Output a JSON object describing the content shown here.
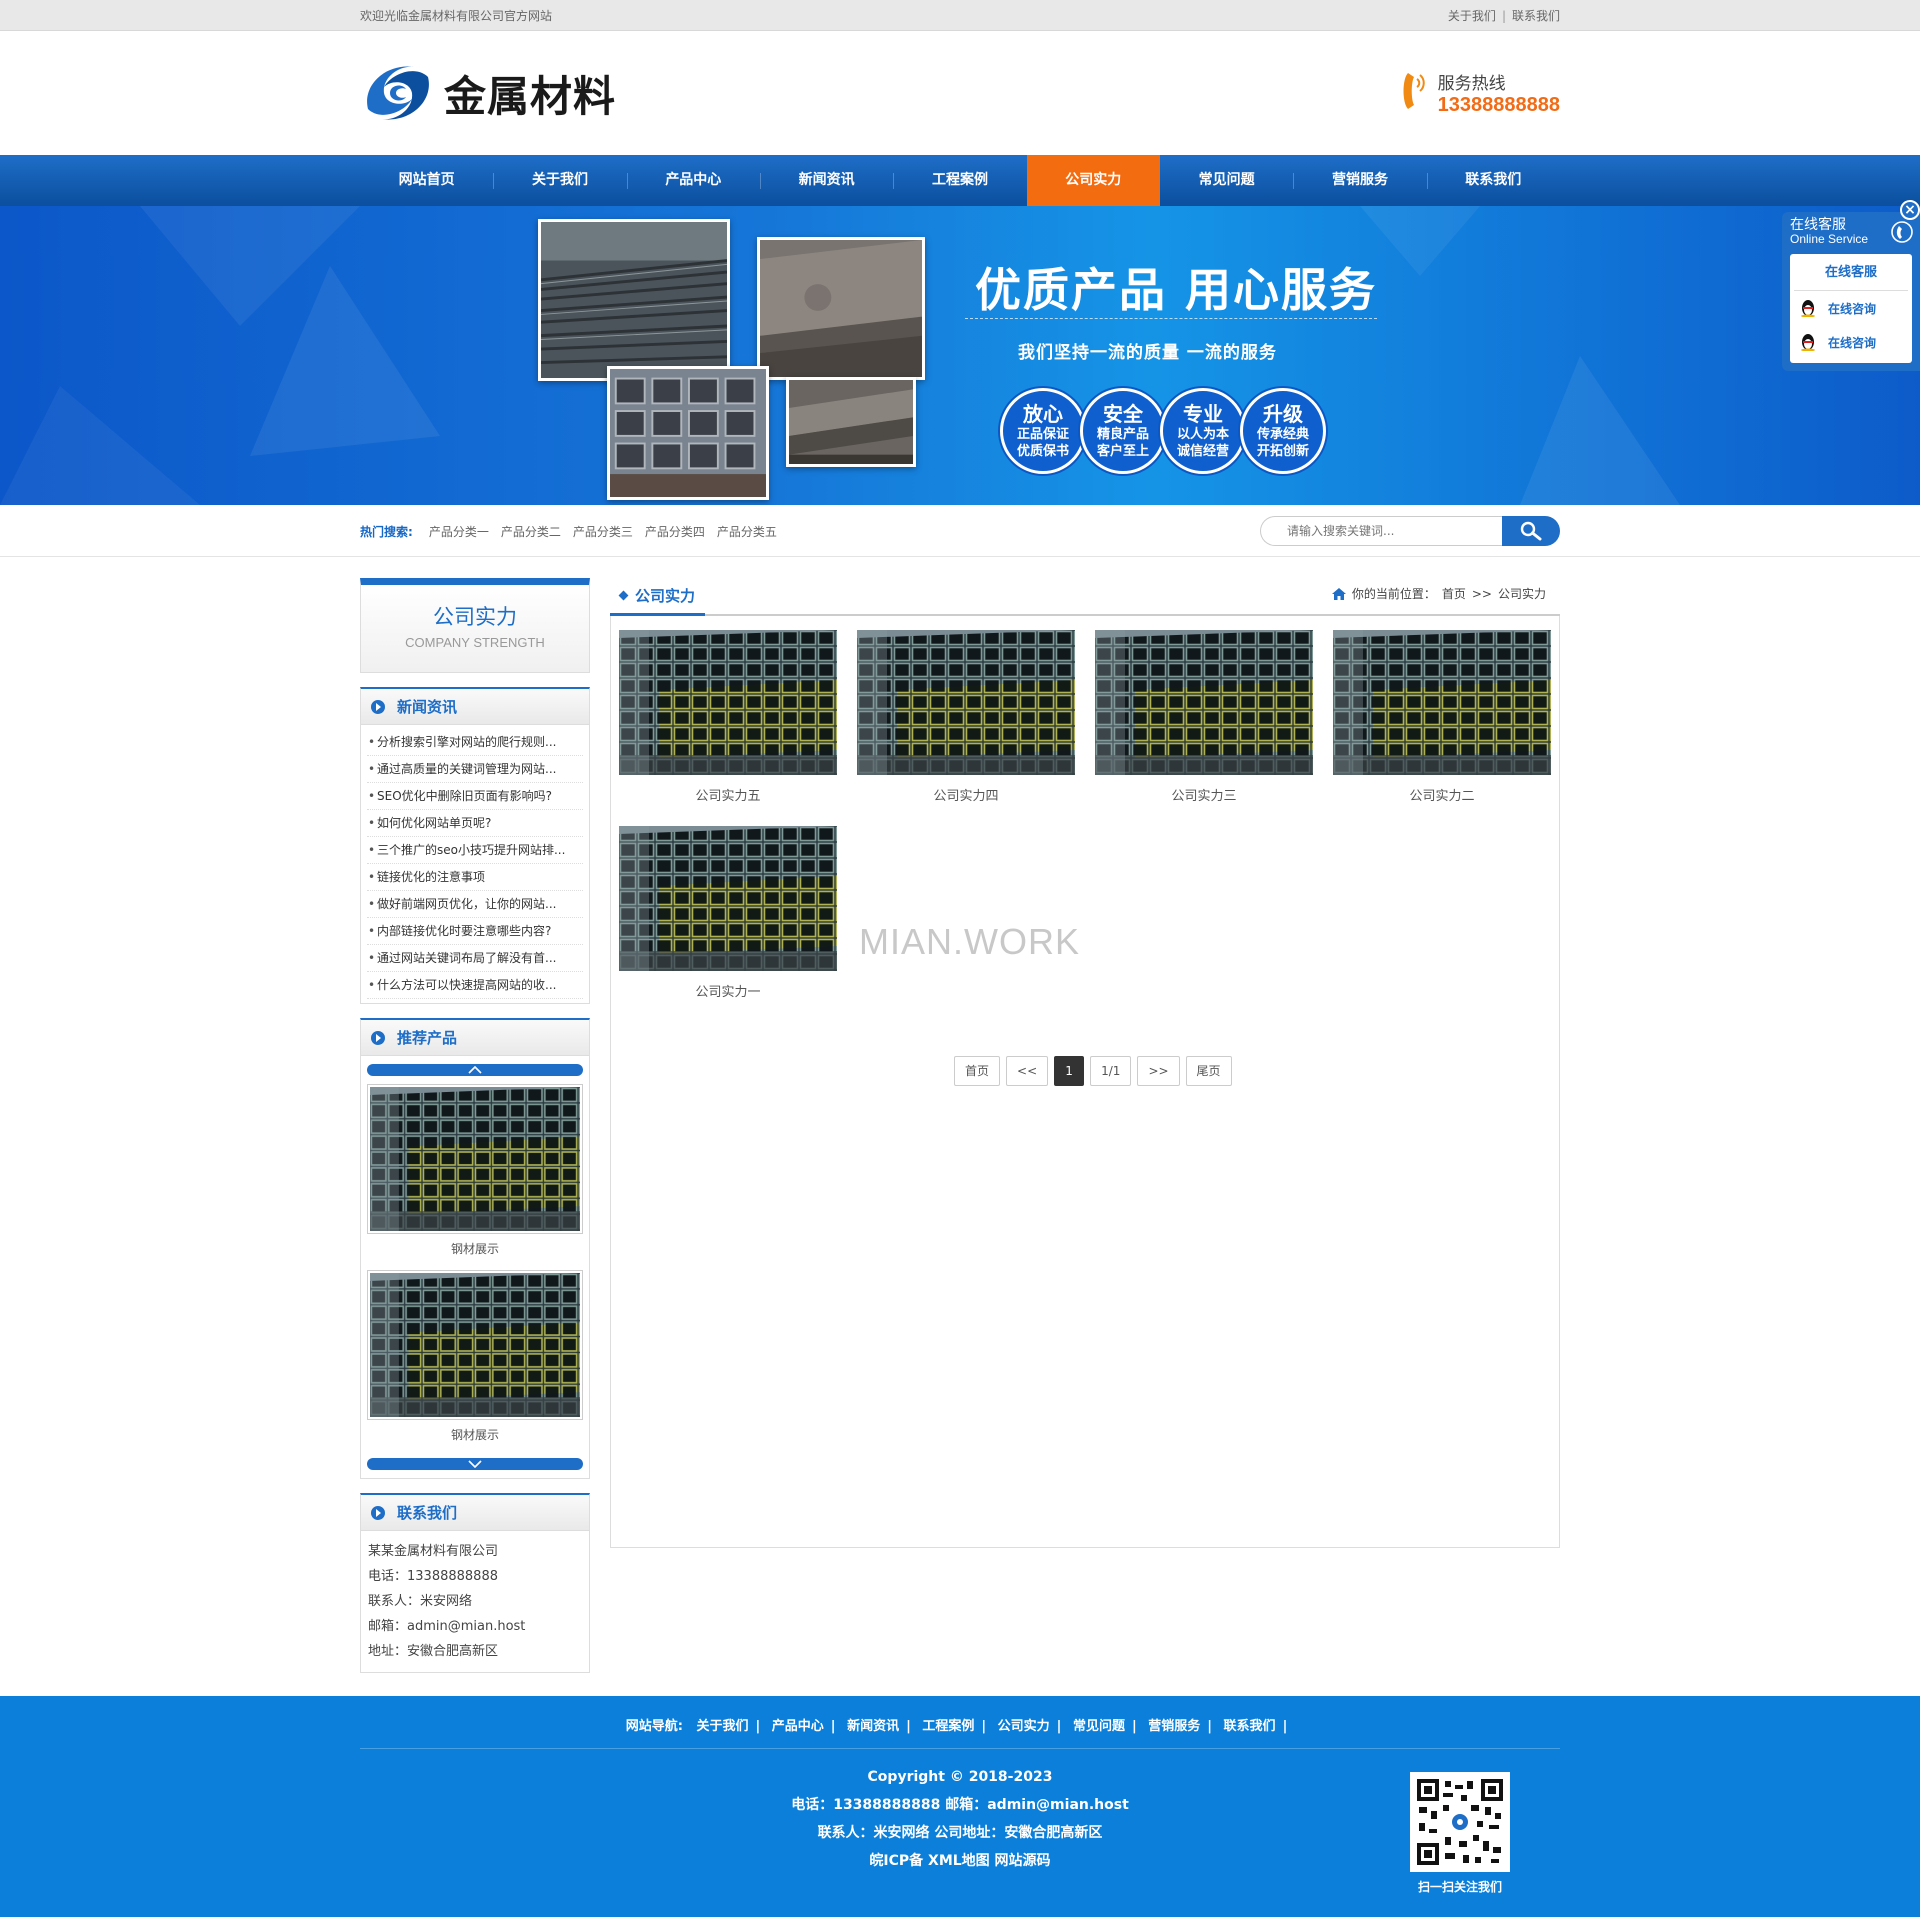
{
  "topbar": {
    "welcome": "欢迎光临金属材料有限公司官方网站",
    "links": [
      "关于我们",
      "联系我们"
    ],
    "separator": "|"
  },
  "header": {
    "logo_text": "金属材料",
    "hotline_label": "服务热线",
    "hotline_number": "13388888888"
  },
  "nav": {
    "items": [
      "网站首页",
      "关于我们",
      "产品中心",
      "新闻资讯",
      "工程案例",
      "公司实力",
      "常见问题",
      "营销服务",
      "联系我们"
    ],
    "active": "公司实力"
  },
  "banner": {
    "title": "优质产品 用心服务",
    "subtitle": "我们坚持一流的质量   一流的服务",
    "badges": [
      {
        "big": "放心",
        "l1": "正品保证",
        "l2": "优质保书"
      },
      {
        "big": "安全",
        "l1": "精良产品",
        "l2": "客户至上"
      },
      {
        "big": "专业",
        "l1": "以人为本",
        "l2": "诚信经营"
      },
      {
        "big": "升级",
        "l1": "传承经典",
        "l2": "开拓创新"
      }
    ]
  },
  "hotsearch": {
    "label": "热门搜索:",
    "keywords": [
      "产品分类一",
      "产品分类二",
      "产品分类三",
      "产品分类四",
      "产品分类五"
    ],
    "placeholder": "请输入搜索关键词..."
  },
  "sidebar": {
    "title_cn": "公司实力",
    "title_en": "COMPANY STRENGTH",
    "news_title": "新闻资讯",
    "news": [
      "分析搜索引擎对网站的爬行规则...",
      "通过高质量的关键词管理为网站...",
      "SEO优化中删除旧页面有影响吗?",
      "如何优化网站单页呢?",
      "三个推广的seo小技巧提升网站排...",
      "链接优化的注意事项",
      "做好前端网页优化，让你的网站...",
      "内部链接优化时要注意哪些内容?",
      "通过网站关键词布局了解没有首...",
      "什么方法可以快速提高网站的收..."
    ],
    "rec_title": "推荐产品",
    "rec_items": [
      "钢材展示",
      "钢材展示"
    ],
    "contact_title": "联系我们",
    "contact": [
      "某某金属材料有限公司",
      "电话：13388888888",
      "联系人：米安网络",
      "邮箱：admin@mian.host",
      "地址：安徽合肥高新区"
    ]
  },
  "content": {
    "tab": "公司实力",
    "crumb_label": "你的当前位置：",
    "crumb_home": "首页",
    "crumb_sep": ">>",
    "crumb_current": "公司实力",
    "items": [
      "公司实力五",
      "公司实力四",
      "公司实力三",
      "公司实力二",
      "公司实力一"
    ],
    "watermark": "MIAN.WORK",
    "pager": [
      "首页",
      "<<",
      "1",
      "1/1",
      ">>",
      "尾页"
    ]
  },
  "footer": {
    "nav_label": "网站导航:",
    "nav": [
      "关于我们",
      "产品中心",
      "新闻资讯",
      "工程案例",
      "公司实力",
      "常见问题",
      "营销服务",
      "联系我们"
    ],
    "copyright": "Copyright © 2018-2023",
    "line2": "电话：13388888888  邮箱：admin@mian.host",
    "line3": "联系人：米安网络     公司地址：安徽合肥高新区",
    "line4": "皖ICP备   XML地图   网站源码",
    "qr_caption": "扫一扫关注我们"
  },
  "kefu": {
    "title": "在线客服",
    "title_en": "Online Service",
    "head": "在线客服",
    "items": [
      "在线咨询",
      "在线咨询"
    ],
    "close": "×"
  },
  "colors": {
    "brand_blue": "#1e6ec8",
    "accent_orange": "#f36c10",
    "footer_blue": "#0b7fd9"
  }
}
